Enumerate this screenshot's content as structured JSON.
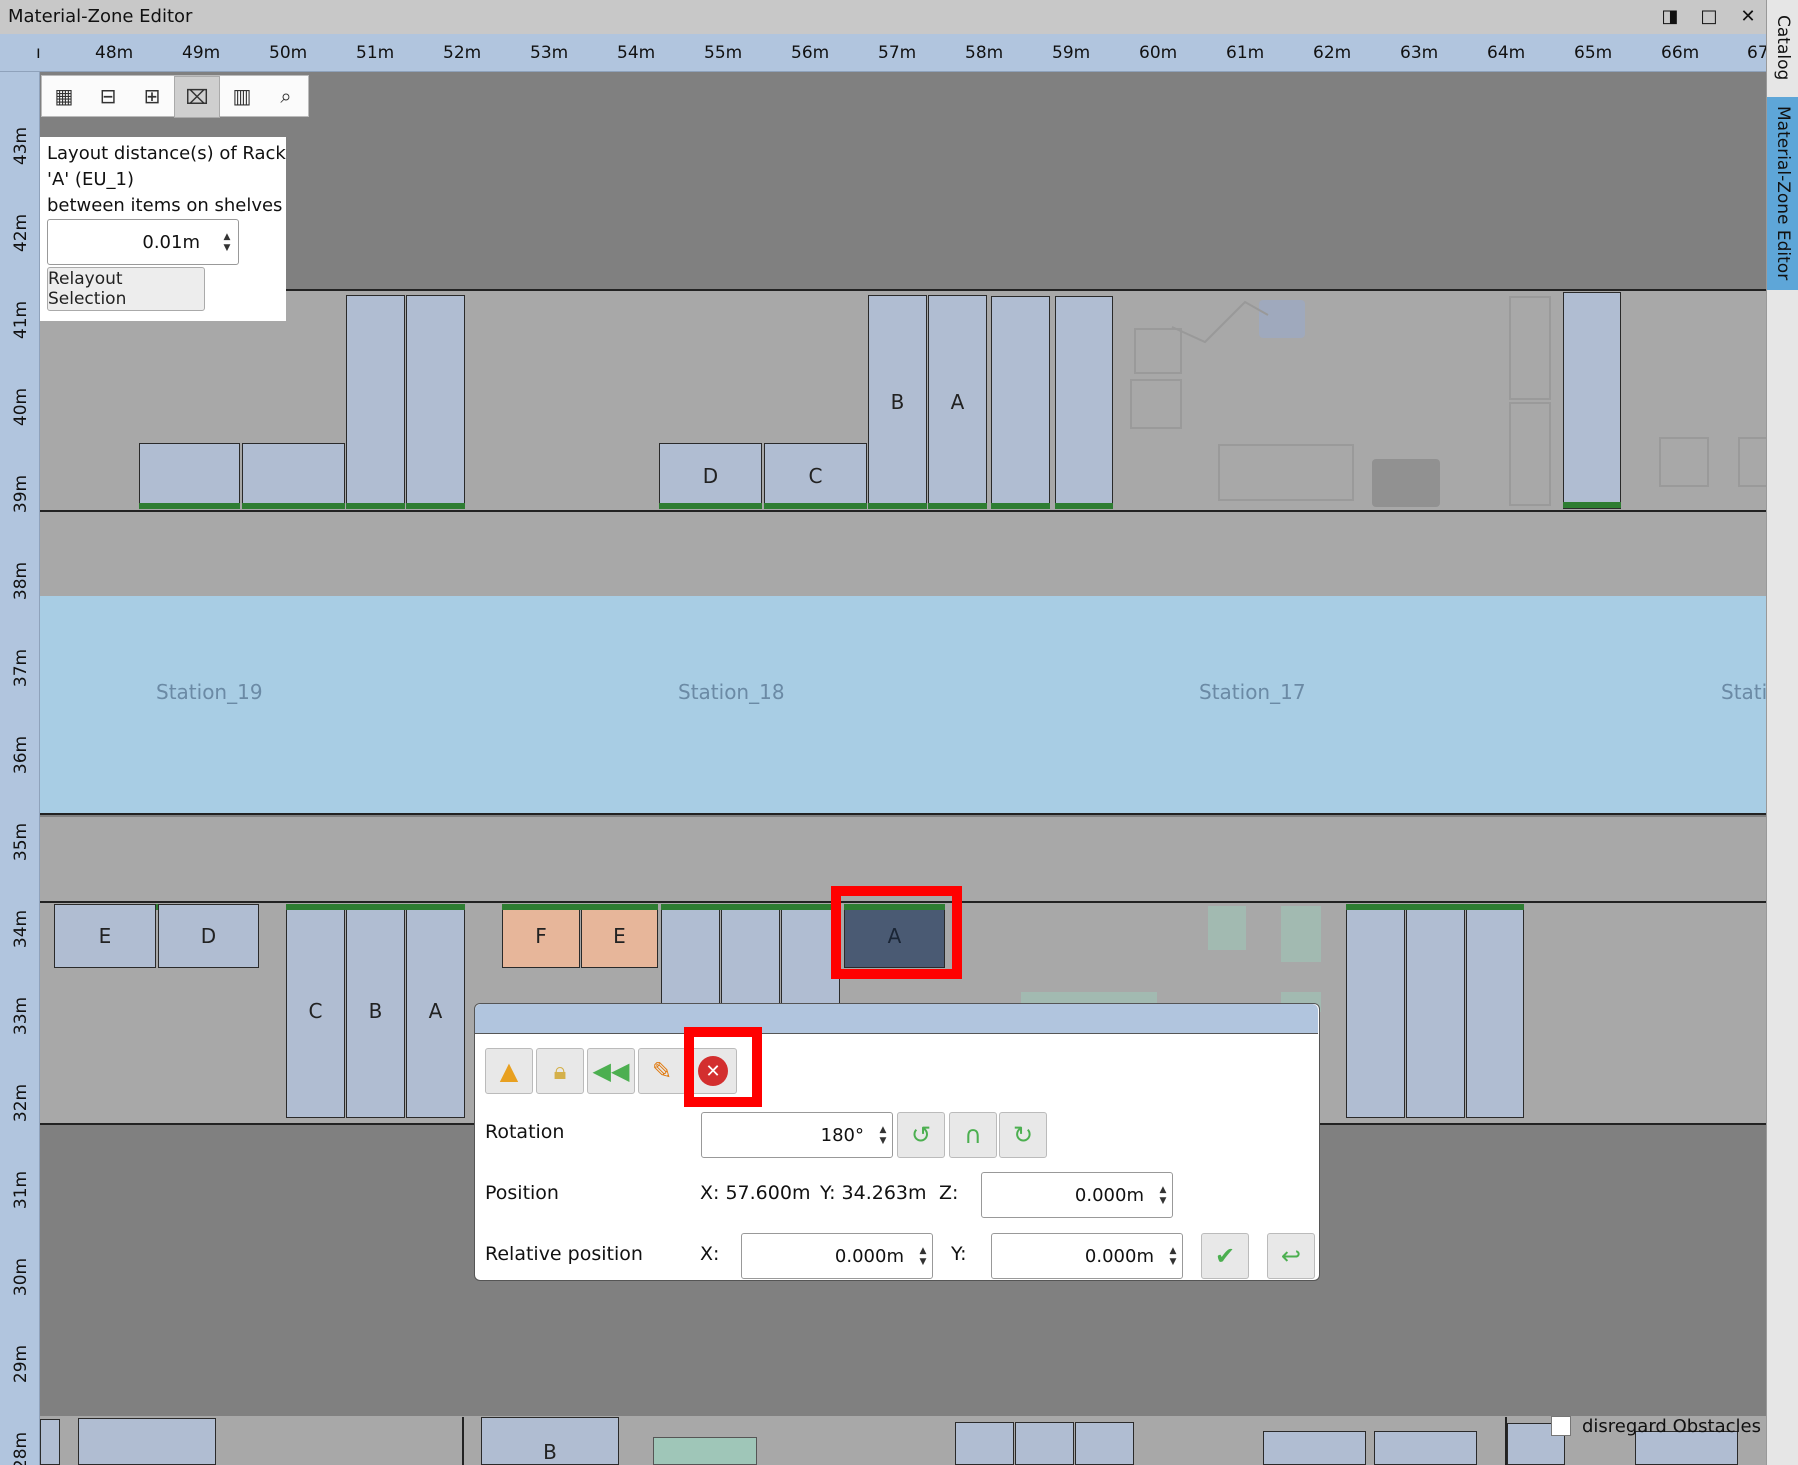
{
  "window": {
    "title": "Material-Zone Editor",
    "buttons": [
      "◨",
      "□",
      "✕"
    ]
  },
  "side_tabs": [
    "Catalog",
    "Material-Zone Editor"
  ],
  "ruler_top": [
    "ı",
    "48m",
    "49m",
    "50m",
    "51m",
    "52m",
    "53m",
    "54m",
    "55m",
    "56m",
    "57m",
    "58m",
    "59m",
    "60m",
    "61m",
    "62m",
    "63m",
    "64m",
    "65m",
    "66m",
    "67"
  ],
  "ruler_left": [
    "43m",
    "42m",
    "41m",
    "40m",
    "39m",
    "38m",
    "37m",
    "36m",
    "35m",
    "34m",
    "33m",
    "32m",
    "31m",
    "30m",
    "29m",
    "28m"
  ],
  "toolbar": {
    "icons": [
      "grid-icon",
      "ruler-icon",
      "dimension-icon",
      "rack-layout-icon",
      "shelf-icon",
      "search-icon"
    ]
  },
  "layout_panel": {
    "line1": "Layout distance(s) of Rack",
    "line2": "'A' (EU_1)",
    "line3": "between items on shelves",
    "distance_value": "0.01m",
    "relayout_button": "Relayout Selection"
  },
  "stations": [
    "Station_19",
    "Station_18",
    "Station_17",
    "Statio"
  ],
  "racks": {
    "top_row": [
      "D",
      "C",
      "B",
      "A"
    ],
    "bottom_row": [
      "E",
      "D",
      "C",
      "B",
      "A",
      "F",
      "E",
      "A"
    ],
    "partial_bottom": "B"
  },
  "properties_popup": {
    "tool_icons": [
      "warning-icon",
      "lock-icon",
      "back-icon",
      "edit-icon",
      "delete-icon"
    ],
    "rotation_label": "Rotation",
    "rotation_value": "180°",
    "position_label": "Position",
    "position_x": "X: 57.600m",
    "position_y": "Y: 34.263m",
    "z_label": "Z:",
    "z_value": "0.000m",
    "relative_label": "Relative position",
    "rel_x_label": "X:",
    "rel_x_value": "0.000m",
    "rel_y_label": "Y:",
    "rel_y_value": "0.000m"
  },
  "disregard_obstacles": "disregard Obstacles",
  "colors": {
    "ruler": "#b1c5de",
    "rack": "#b0bdd2",
    "rack_selected": "#4a5a73",
    "rack_orange": "#e7b69a",
    "station": "#a8cde4",
    "highlight": "#ff0000",
    "shelf_edge": "#2e7d32"
  }
}
